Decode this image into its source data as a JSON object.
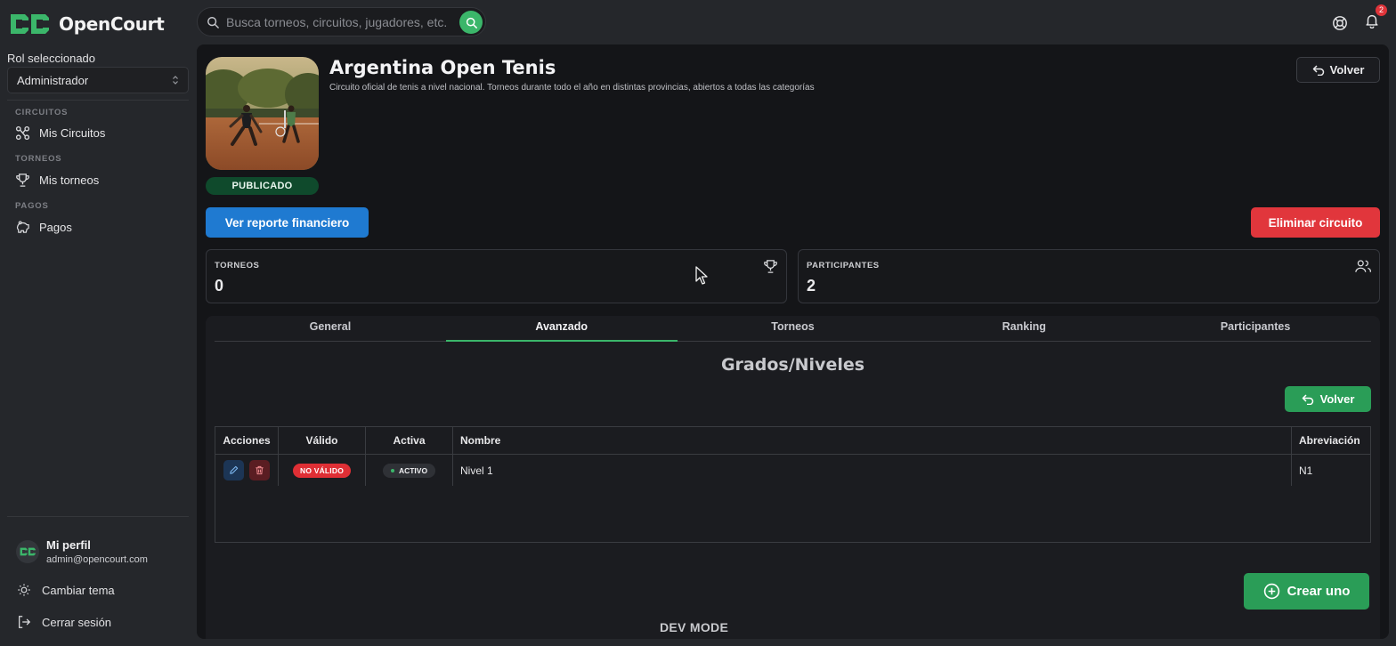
{
  "app": {
    "name": "OpenCourt"
  },
  "search": {
    "placeholder": "Busca torneos, circuitos, jugadores, etc."
  },
  "notifications": {
    "count": "2"
  },
  "sidebar": {
    "role_label": "Rol seleccionado",
    "role_value": "Administrador",
    "sections": [
      {
        "title": "CIRCUITOS",
        "item": "Mis Circuitos"
      },
      {
        "title": "TORNEOS",
        "item": "Mis torneos"
      },
      {
        "title": "PAGOS",
        "item": "Pagos"
      }
    ],
    "profile": {
      "name": "Mi perfil",
      "email": "admin@opencourt.com"
    },
    "theme_label": "Cambiar tema",
    "logout_label": "Cerrar sesión"
  },
  "circuit": {
    "title": "Argentina Open Tenis",
    "description": "Circuito oficial de tenis a nivel nacional. Torneos durante todo el año en distintas provincias, abiertos a todas las categorías",
    "status": "PUBLICADO",
    "back_label": "Volver",
    "report_label": "Ver reporte financiero",
    "delete_label": "Eliminar circuito"
  },
  "stats": [
    {
      "label": "TORNEOS",
      "value": "0",
      "icon": "trophy-icon"
    },
    {
      "label": "PARTICIPANTES",
      "value": "2",
      "icon": "users-icon"
    }
  ],
  "tabs": [
    {
      "label": "General",
      "active": false
    },
    {
      "label": "Avanzado",
      "active": true
    },
    {
      "label": "Torneos",
      "active": false
    },
    {
      "label": "Ranking",
      "active": false
    },
    {
      "label": "Participantes",
      "active": false
    }
  ],
  "levels": {
    "heading": "Grados/Niveles",
    "back_label": "Volver",
    "columns": [
      "Acciones",
      "Válido",
      "Activa",
      "Nombre",
      "Abreviación"
    ],
    "rows": [
      {
        "valid": "NO VÁLIDO",
        "active": "ACTIVO",
        "name": "Nivel 1",
        "abbr": "N1"
      }
    ],
    "create_label": "Crear uno"
  },
  "footer": {
    "dev_mode": "DEV MODE"
  },
  "colors": {
    "brand_green": "#3bb66a",
    "primary_blue": "#1f7ad1",
    "danger_red": "#e1363c",
    "background": "#25272b",
    "panel": "#141518"
  }
}
